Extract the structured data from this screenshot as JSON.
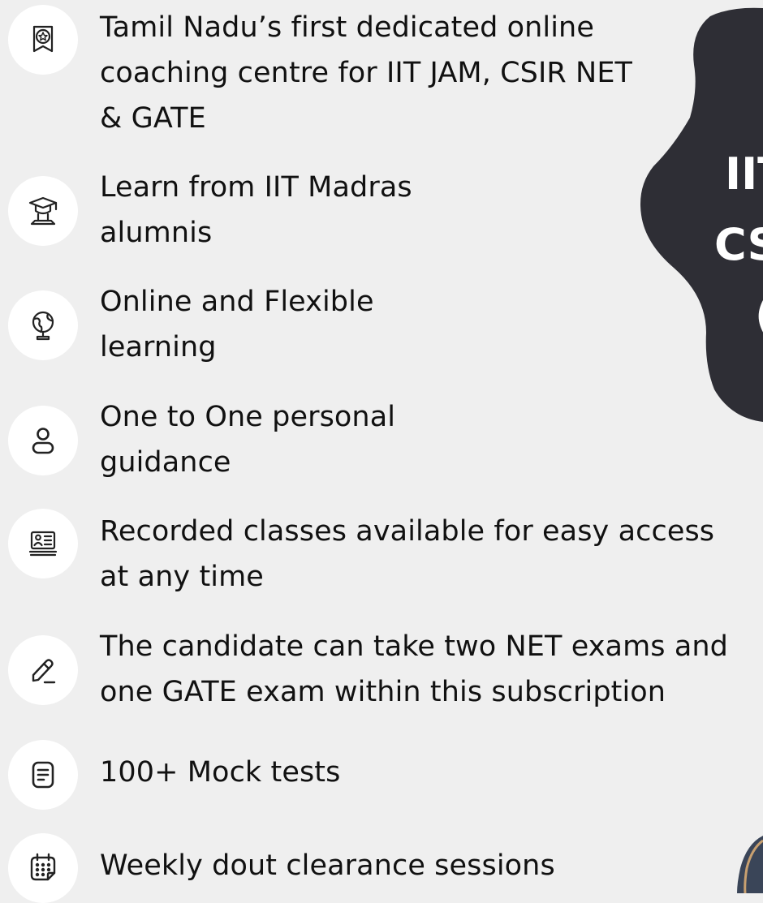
{
  "features": [
    {
      "icon": "award-badge-icon",
      "lines": [
        "Tamil Nadu’s first dedicated online",
        "coaching centre for IIT JAM, CSIR NET",
        "& GATE"
      ]
    },
    {
      "icon": "graduate-icon",
      "lines": [
        "Learn from IIT Madras",
        "alumnis"
      ]
    },
    {
      "icon": "globe-icon",
      "lines": [
        "Online and Flexible",
        "learning"
      ]
    },
    {
      "icon": "user-icon",
      "lines": [
        "One to One personal",
        "guidance"
      ]
    },
    {
      "icon": "laptop-profile-icon",
      "lines": [
        "Recorded classes available for easy access",
        "at any time"
      ]
    },
    {
      "icon": "pencil-icon",
      "lines": [
        "The candidate can take two NET exams and",
        "one GATE exam within this subscription"
      ]
    },
    {
      "icon": "document-icon",
      "lines": [
        "100+ Mock tests"
      ]
    },
    {
      "icon": "calendar-icon",
      "lines": [
        "Weekly dout clearance sessions"
      ]
    }
  ],
  "banner": {
    "line1": "IIT",
    "line2": "CS",
    "line3": "(",
    "color": "#2e2e35"
  },
  "colors": {
    "background": "#efefef",
    "icon_bg": "#ffffff",
    "text": "#111111"
  }
}
